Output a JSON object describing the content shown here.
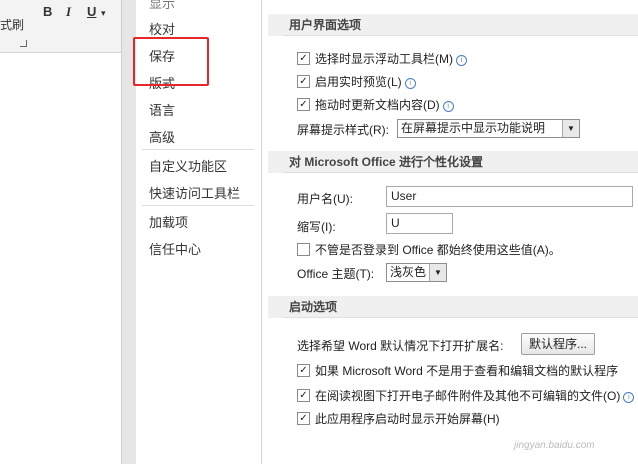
{
  "ribbon": {
    "partial_text_top": "显示",
    "style_label": "式刷",
    "bold": "B",
    "italic": "I",
    "underline": "U",
    "underline_arrow": "▾"
  },
  "nav": {
    "items": [
      {
        "label": "显示"
      },
      {
        "label": "校对"
      },
      {
        "label": "保存"
      },
      {
        "label": "版式"
      },
      {
        "label": "语言"
      },
      {
        "label": "高级"
      },
      {
        "label": "自定义功能区"
      },
      {
        "label": "快速访问工具栏"
      },
      {
        "label": "加载项"
      },
      {
        "label": "信任中心"
      }
    ]
  },
  "ui_options": {
    "header": "用户界面选项",
    "mini_toolbar": {
      "label": "选择时显示浮动工具栏(M)",
      "checked": true
    },
    "live_preview": {
      "label": "启用实时预览(L)",
      "checked": true
    },
    "update_drag": {
      "label": "拖动时更新文档内容(D)",
      "checked": true
    },
    "screentip_label": "屏幕提示样式(R):",
    "screentip_value": "在屏幕提示中显示功能说明"
  },
  "personalize": {
    "header": "对 Microsoft Office 进行个性化设置",
    "username_label": "用户名(U):",
    "username_value": "User",
    "initials_label": "缩写(I):",
    "initials_value": "U",
    "always_use": {
      "label": "不管是否登录到 Office 都始终使用这些值(A)。",
      "checked": false
    },
    "theme_label": "Office 主题(T):",
    "theme_value": "浅灰色"
  },
  "startup": {
    "header": "启动选项",
    "default_ext_label": "选择希望 Word 默认情况下打开扩展名:",
    "default_programs_button": "默认程序...",
    "not_default_warn": {
      "label": "如果 Microsoft Word 不是用于查看和编辑文档的默认程序",
      "checked": true
    },
    "reading_view": {
      "label": "在阅读视图下打开电子邮件附件及其他不可编辑的文件(O)",
      "checked": true
    },
    "start_screen": {
      "label": "此应用程序启动时显示开始屏幕(H)",
      "checked": true
    }
  },
  "watermark": "jingyan.baidu.com",
  "colors": {
    "highlight_box": "#e8272a",
    "section_bg": "#f0f0f0",
    "info_icon": "#4a7fc1"
  }
}
